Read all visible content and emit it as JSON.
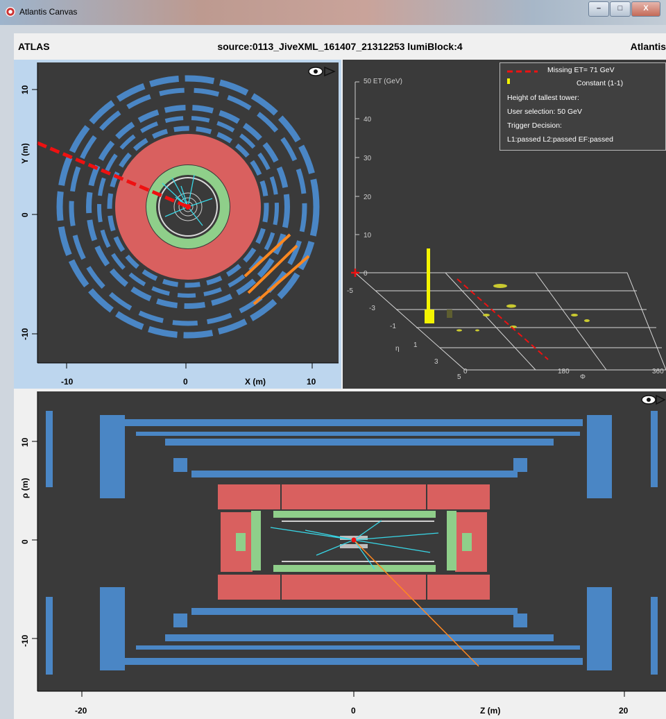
{
  "window": {
    "title": "Atlantis Canvas",
    "minimize_glyph": "–",
    "maximize_glyph": "□",
    "close_glyph": "X"
  },
  "header": {
    "left": "ATLAS",
    "center": "source:0113_JiveXML_161407_21312253 lumiBlock:4",
    "right": "Atlantis"
  },
  "xy_view": {
    "y_axis_label": "Y (m)",
    "x_axis_label": "X (m)",
    "y_ticks": [
      "10",
      "0",
      "-10"
    ],
    "x_ticks": [
      "-10",
      "0",
      "10"
    ]
  },
  "lego_view": {
    "et_axis_label": "50 ET (GeV)",
    "et_ticks": [
      "40",
      "30",
      "20",
      "10",
      "0"
    ],
    "eta_label": "η",
    "eta_ticks": [
      "-5",
      "-3",
      "-1",
      "1",
      "3",
      "5"
    ],
    "phi_label": "Φ",
    "phi_ticks": [
      "0",
      "180",
      "360"
    ],
    "legend": {
      "missing_et": "Missing ET= 71 GeV",
      "constant": "Constant (1-1)",
      "tallest": "Height of tallest tower:",
      "user_selection": "User selection: 50 GeV",
      "trigger_decision": "Trigger Decision:",
      "trigger_result": "L1:passed L2:passed EF:passed"
    }
  },
  "rz_view": {
    "y_axis_label": "ρ (m)",
    "x_axis_label": "Z (m)",
    "y_ticks": [
      "10",
      "0",
      "-10"
    ],
    "x_ticks": [
      "-20",
      "0",
      "20"
    ]
  },
  "colors": {
    "background": "#3a3a3a",
    "muon": "#4a86c5",
    "hadronic_calo": "#d9605f",
    "em_calo": "#8fcf8a",
    "tracks": "#38d8e8",
    "missing_et": "#ee1111",
    "muon_hits": "#ff8820",
    "tower": "#f4f400"
  }
}
